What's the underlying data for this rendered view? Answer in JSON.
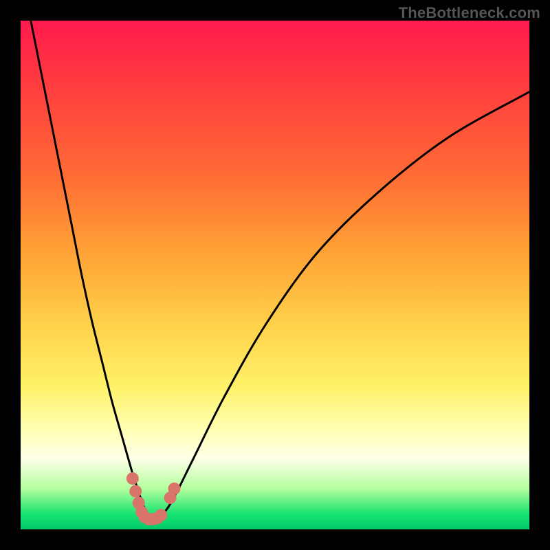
{
  "watermark": "TheBottleneck.com",
  "chart_data": {
    "type": "line",
    "title": "",
    "xlabel": "",
    "ylabel": "",
    "xlim": [
      0,
      100
    ],
    "ylim": [
      0,
      100
    ],
    "series": [
      {
        "name": "bottleneck-curve",
        "x": [
          2,
          4,
          6,
          8,
          10,
          12,
          14,
          16,
          18,
          20,
          22,
          23,
          24,
          25,
          26,
          27,
          28,
          30,
          34,
          40,
          48,
          58,
          70,
          84,
          100
        ],
        "y": [
          100,
          90,
          80,
          70,
          60,
          50,
          41,
          33,
          25,
          18,
          11,
          8,
          5,
          3,
          2,
          2,
          3,
          6,
          14,
          26,
          40,
          54,
          66,
          77,
          86
        ]
      }
    ],
    "markers": {
      "name": "highlight-points",
      "color": "#d9746b",
      "points": [
        {
          "x": 22.0,
          "y": 10.0
        },
        {
          "x": 22.6,
          "y": 7.5
        },
        {
          "x": 23.2,
          "y": 5.2
        },
        {
          "x": 23.8,
          "y": 3.4
        },
        {
          "x": 24.4,
          "y": 2.4
        },
        {
          "x": 25.2,
          "y": 2.0
        },
        {
          "x": 26.0,
          "y": 2.0
        },
        {
          "x": 26.8,
          "y": 2.2
        },
        {
          "x": 27.6,
          "y": 2.8
        },
        {
          "x": 29.4,
          "y": 6.2
        },
        {
          "x": 30.2,
          "y": 8.0
        }
      ]
    }
  }
}
